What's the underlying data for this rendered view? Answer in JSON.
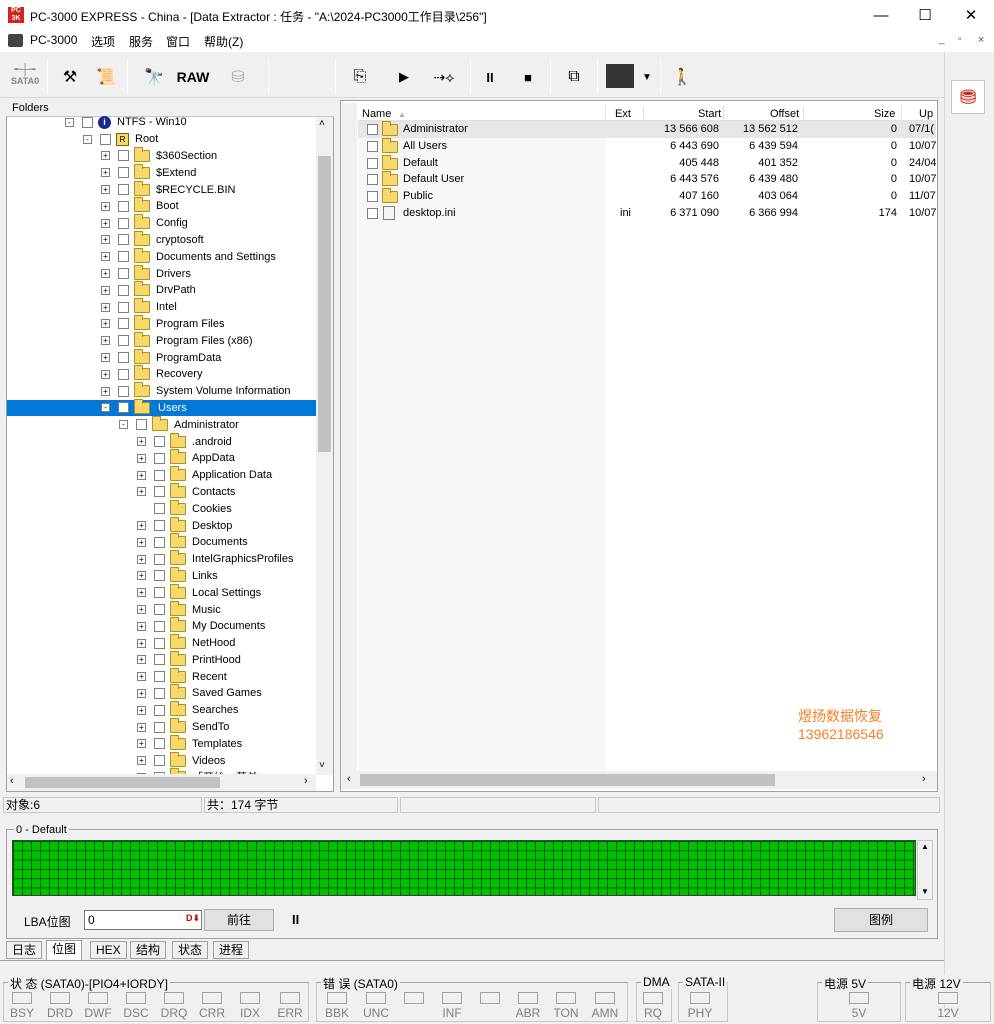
{
  "titlebar": {
    "title": "PC-3000 EXPRESS - China - [Data Extractor : 任务 - \"A:\\2024-PC3000工作目录\\256\"]",
    "min": "—",
    "max": "☐",
    "close": "✕"
  },
  "menu": {
    "items": [
      "PC-3000",
      "选项",
      "服务",
      "窗口",
      "帮助(Z)"
    ]
  },
  "toolbar": {
    "sata_label": "SATA0",
    "raw_label": "RAW"
  },
  "folders": {
    "header": "Folders",
    "rows": [
      {
        "d": 3,
        "exp": "-",
        "cb": true,
        "icon": "info",
        "label": "NTFS - Win10"
      },
      {
        "d": 4,
        "exp": "-",
        "cb": true,
        "icon": "root",
        "label": "Root"
      },
      {
        "d": 5,
        "exp": "+",
        "cb": true,
        "icon": "folder",
        "label": "$360Section"
      },
      {
        "d": 5,
        "exp": "+",
        "cb": true,
        "icon": "folder",
        "label": "$Extend"
      },
      {
        "d": 5,
        "exp": "+",
        "cb": true,
        "icon": "folder",
        "label": "$RECYCLE.BIN"
      },
      {
        "d": 5,
        "exp": "+",
        "cb": true,
        "icon": "folder",
        "label": "Boot"
      },
      {
        "d": 5,
        "exp": "+",
        "cb": true,
        "icon": "folder",
        "label": "Config"
      },
      {
        "d": 5,
        "exp": "+",
        "cb": true,
        "icon": "folder",
        "label": "cryptosoft"
      },
      {
        "d": 5,
        "exp": "+",
        "cb": true,
        "icon": "folder",
        "label": "Documents and Settings"
      },
      {
        "d": 5,
        "exp": "+",
        "cb": true,
        "icon": "folder",
        "label": "Drivers"
      },
      {
        "d": 5,
        "exp": "+",
        "cb": true,
        "icon": "folder",
        "label": "DrvPath"
      },
      {
        "d": 5,
        "exp": "+",
        "cb": true,
        "icon": "folder",
        "label": "Intel"
      },
      {
        "d": 5,
        "exp": "+",
        "cb": true,
        "icon": "folder",
        "label": "Program Files"
      },
      {
        "d": 5,
        "exp": "+",
        "cb": true,
        "icon": "folder",
        "label": "Program Files (x86)"
      },
      {
        "d": 5,
        "exp": "+",
        "cb": true,
        "icon": "folder",
        "label": "ProgramData"
      },
      {
        "d": 5,
        "exp": "+",
        "cb": true,
        "icon": "folder",
        "label": "Recovery"
      },
      {
        "d": 5,
        "exp": "+",
        "cb": true,
        "icon": "folder",
        "label": "System Volume Information"
      },
      {
        "d": 5,
        "exp": "-",
        "cb": true,
        "icon": "folder",
        "label": "Users",
        "sel": true
      },
      {
        "d": 6,
        "exp": "-",
        "cb": true,
        "icon": "folder",
        "label": "Administrator"
      },
      {
        "d": 7,
        "exp": "+",
        "cb": true,
        "icon": "folder",
        "label": ".android"
      },
      {
        "d": 7,
        "exp": "+",
        "cb": true,
        "icon": "folder",
        "label": "AppData"
      },
      {
        "d": 7,
        "exp": "+",
        "cb": true,
        "icon": "folder",
        "label": "Application Data"
      },
      {
        "d": 7,
        "exp": "+",
        "cb": true,
        "icon": "folder",
        "label": "Contacts"
      },
      {
        "d": 7,
        "exp": "",
        "cb": true,
        "icon": "folder",
        "label": "Cookies"
      },
      {
        "d": 7,
        "exp": "+",
        "cb": true,
        "icon": "folder",
        "label": "Desktop"
      },
      {
        "d": 7,
        "exp": "+",
        "cb": true,
        "icon": "folder",
        "label": "Documents"
      },
      {
        "d": 7,
        "exp": "+",
        "cb": true,
        "icon": "folder",
        "label": "IntelGraphicsProfiles"
      },
      {
        "d": 7,
        "exp": "+",
        "cb": true,
        "icon": "folder",
        "label": "Links"
      },
      {
        "d": 7,
        "exp": "+",
        "cb": true,
        "icon": "folder",
        "label": "Local Settings"
      },
      {
        "d": 7,
        "exp": "+",
        "cb": true,
        "icon": "folder",
        "label": "Music"
      },
      {
        "d": 7,
        "exp": "+",
        "cb": true,
        "icon": "folder",
        "label": "My Documents"
      },
      {
        "d": 7,
        "exp": "+",
        "cb": true,
        "icon": "folder",
        "label": "NetHood"
      },
      {
        "d": 7,
        "exp": "+",
        "cb": true,
        "icon": "folder",
        "label": "PrintHood"
      },
      {
        "d": 7,
        "exp": "+",
        "cb": true,
        "icon": "folder",
        "label": "Recent"
      },
      {
        "d": 7,
        "exp": "+",
        "cb": true,
        "icon": "folder",
        "label": "Saved Games"
      },
      {
        "d": 7,
        "exp": "+",
        "cb": true,
        "icon": "folder",
        "label": "Searches"
      },
      {
        "d": 7,
        "exp": "+",
        "cb": true,
        "icon": "folder",
        "label": "SendTo"
      },
      {
        "d": 7,
        "exp": "+",
        "cb": true,
        "icon": "folder",
        "label": "Templates"
      },
      {
        "d": 7,
        "exp": "+",
        "cb": true,
        "icon": "folder",
        "label": "Videos"
      },
      {
        "d": 7,
        "exp": "+",
        "cb": true,
        "icon": "folder",
        "label": "「开始」菜单"
      }
    ]
  },
  "files": {
    "columns": [
      "Name",
      "Ext",
      "Start",
      "Offset",
      "Size",
      "Up"
    ],
    "rows": [
      {
        "name": "Administrator",
        "ext": "",
        "start": "13 566 608",
        "offset": "13 562 512",
        "size": "0",
        "up": "07/1(",
        "icon": "folder",
        "sel": true
      },
      {
        "name": "All Users",
        "ext": "",
        "start": "6 443 690",
        "offset": "6 439 594",
        "size": "0",
        "up": "10/07",
        "icon": "folder"
      },
      {
        "name": "Default",
        "ext": "",
        "start": "405 448",
        "offset": "401 352",
        "size": "0",
        "up": "24/04",
        "icon": "folder"
      },
      {
        "name": "Default User",
        "ext": "",
        "start": "6 443 576",
        "offset": "6 439 480",
        "size": "0",
        "up": "10/07",
        "icon": "folder"
      },
      {
        "name": "Public",
        "ext": "",
        "start": "407 160",
        "offset": "403 064",
        "size": "0",
        "up": "11/07",
        "icon": "folder"
      },
      {
        "name": "desktop.ini",
        "ext": "ini",
        "start": "6 371 090",
        "offset": "6 366 994",
        "size": "174",
        "up": "10/07",
        "icon": "file"
      }
    ]
  },
  "watermark": {
    "line1": "煜扬数据恢复",
    "line2": "13962186546"
  },
  "status": {
    "objects": "对象:6",
    "total": "共：174 字节"
  },
  "map": {
    "label": "0 - Default",
    "lba_label": "LBA位图",
    "lba_value": "0",
    "go": "前往",
    "pause": "II",
    "legend": "图例"
  },
  "tabs": [
    "日志",
    "位图",
    "HEX",
    "结构",
    "状态",
    "进程"
  ],
  "bottom": {
    "g1": "状 态 (SATA0)-[PIO4+IORDY]",
    "g1_leds": [
      "BSY",
      "DRD",
      "DWF",
      "DSC",
      "DRQ",
      "CRR",
      "IDX",
      "ERR"
    ],
    "g2": "错 误 (SATA0)",
    "g2_leds": [
      "BBK",
      "UNC",
      "",
      "INF",
      "",
      "ABR",
      "TON",
      "AMN"
    ],
    "g3": "DMA",
    "g3_leds": [
      "RQ"
    ],
    "g4": "SATA-II",
    "g4_leds": [
      "PHY"
    ],
    "g5": "电源 5V",
    "g5_leds": [
      "5V"
    ],
    "g6": "电源 12V",
    "g6_leds": [
      "12V"
    ]
  }
}
